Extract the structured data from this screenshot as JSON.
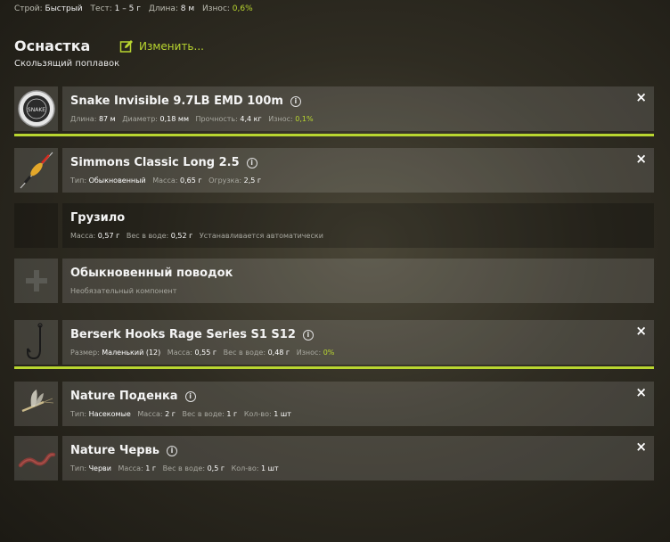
{
  "topbar": {
    "action_label": "Строй:",
    "action_value": "Быстрый",
    "test_label": "Тест:",
    "test_value": "1 – 5 г",
    "length_label": "Длина:",
    "length_value": "8 м",
    "wear_label": "Износ:",
    "wear_value": "0,6%"
  },
  "header": {
    "title": "Оснастка",
    "edit_label": "Изменить...",
    "subtitle": "Скользящий поплавок"
  },
  "colors": {
    "accent": "#b9d630"
  },
  "slots": {
    "line": {
      "name": "Snake Invisible 9.7LB EMD 100m",
      "stats": [
        {
          "label": "Длина:",
          "value": "87 м"
        },
        {
          "label": "Диаметр:",
          "value": "0,18 мм"
        },
        {
          "label": "Прочность:",
          "value": "4,4 кг"
        },
        {
          "label": "Износ:",
          "value": "0,1%"
        }
      ]
    },
    "float": {
      "name": "Simmons Classic Long 2.5",
      "stats": [
        {
          "label": "Тип:",
          "value": "Обыкновенный"
        },
        {
          "label": "Масса:",
          "value": "0,65 г"
        },
        {
          "label": "Огрузка:",
          "value": "2,5 г"
        }
      ]
    },
    "sinker": {
      "name": "Грузило",
      "stats": [
        {
          "label": "Масса:",
          "value": "0,57 г"
        },
        {
          "label": "Вес в воде:",
          "value": "0,52 г"
        }
      ],
      "note": "Устанавливается автоматически"
    },
    "leader": {
      "name": "Обыкновенный поводок",
      "note": "Необязательный компонент"
    },
    "hook": {
      "name": "Berserk Hooks Rage Series S1 S12",
      "stats": [
        {
          "label": "Размер:",
          "value": "Маленький (12)"
        },
        {
          "label": "Масса:",
          "value": "0,55 г"
        },
        {
          "label": "Вес в воде:",
          "value": "0,48 г"
        },
        {
          "label": "Износ:",
          "value": "0%"
        }
      ]
    },
    "bait1": {
      "name": "Nature Поденка",
      "stats": [
        {
          "label": "Тип:",
          "value": "Насекомые"
        },
        {
          "label": "Масса:",
          "value": "2 г"
        },
        {
          "label": "Вес в воде:",
          "value": "1 г"
        },
        {
          "label": "Кол-во:",
          "value": "1 шт"
        }
      ]
    },
    "bait2": {
      "name": "Nature Червь",
      "stats": [
        {
          "label": "Тип:",
          "value": "Черви"
        },
        {
          "label": "Масса:",
          "value": "1 г"
        },
        {
          "label": "Вес в воде:",
          "value": "0,5 г"
        },
        {
          "label": "Кол-во:",
          "value": "1 шт"
        }
      ]
    }
  },
  "icons": {
    "close": "×",
    "info": "i",
    "line_logo_text": "SNAKE"
  }
}
